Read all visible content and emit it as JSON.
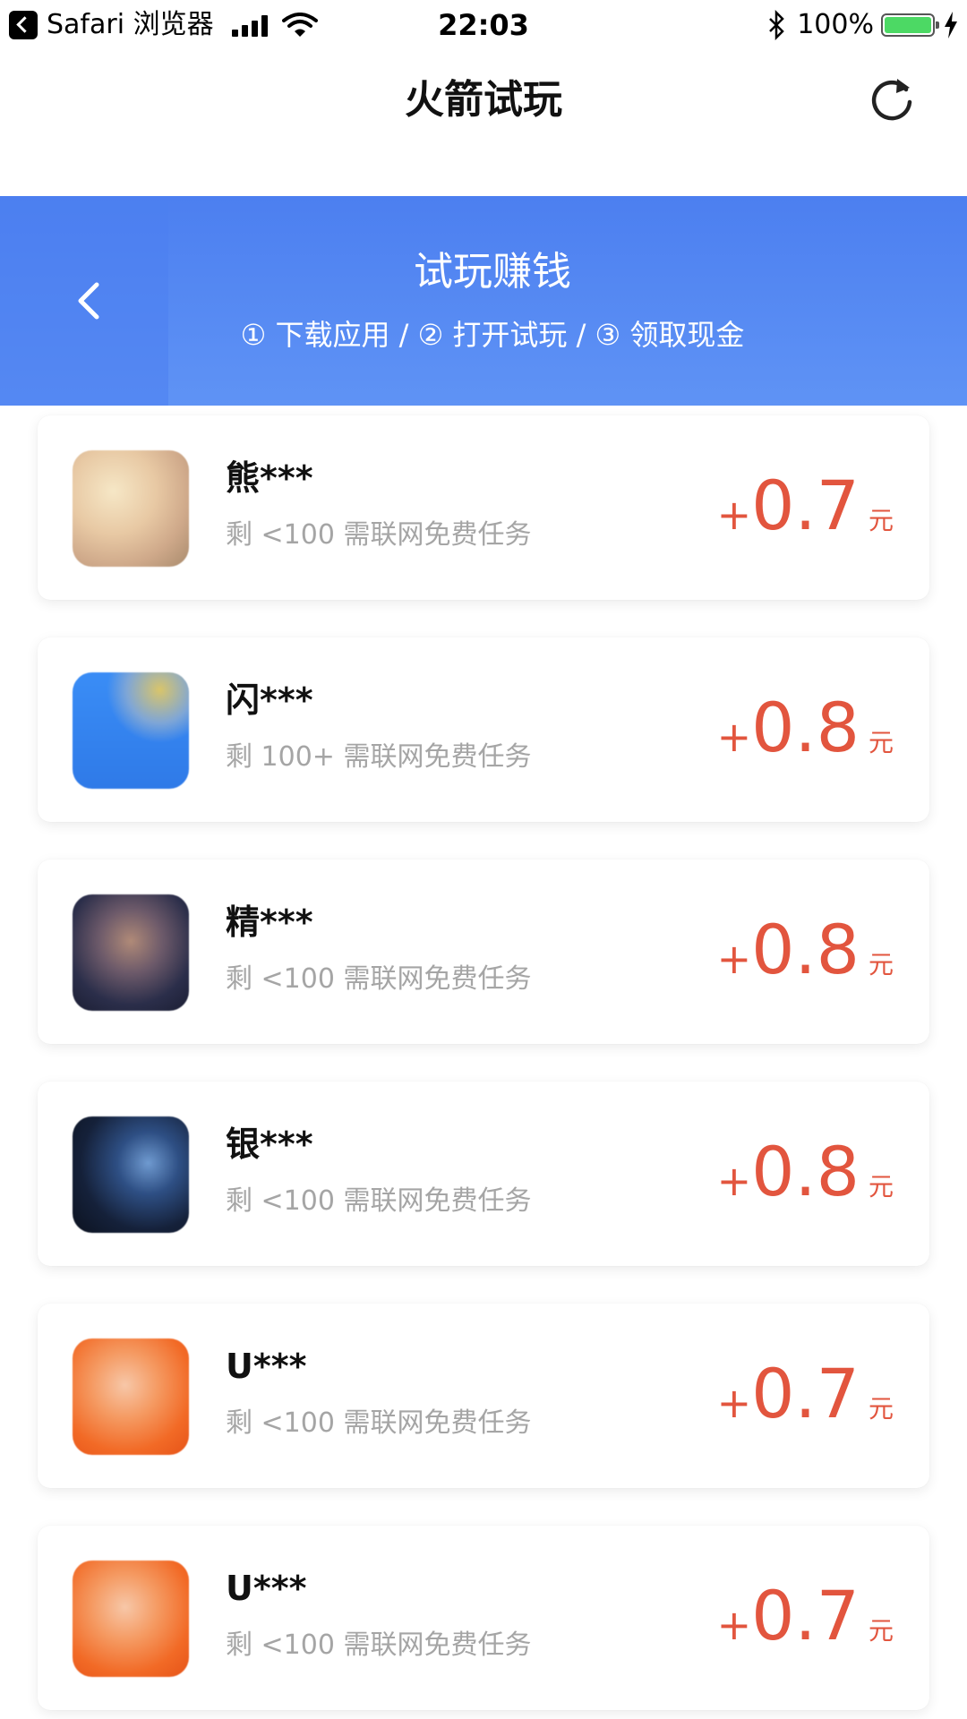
{
  "status_bar": {
    "back_app_label": "Safari 浏览器",
    "time": "22:03",
    "battery_percent": "100%",
    "battery_color": "#4cd964"
  },
  "nav": {
    "title": "火箭试玩",
    "refresh_icon": "refresh-icon"
  },
  "banner": {
    "title": "试玩赚钱",
    "steps": "① 下载应用 / ② 打开试玩 / ③ 领取现金",
    "background": "#5a8cf3"
  },
  "tasks": [
    {
      "name": "熊***",
      "subtitle": "剩 <100 需联网免费任务",
      "plus": "+",
      "amount": "0.7",
      "unit": "元"
    },
    {
      "name": "闪***",
      "subtitle": "剩 100+ 需联网免费任务",
      "plus": "+",
      "amount": "0.8",
      "unit": "元"
    },
    {
      "name": "精***",
      "subtitle": "剩 <100 需联网免费任务",
      "plus": "+",
      "amount": "0.8",
      "unit": "元"
    },
    {
      "name": "银***",
      "subtitle": "剩 <100 需联网免费任务",
      "plus": "+",
      "amount": "0.8",
      "unit": "元"
    },
    {
      "name": "U***",
      "subtitle": "剩 <100 需联网免费任务",
      "plus": "+",
      "amount": "0.7",
      "unit": "元"
    },
    {
      "name": "U***",
      "subtitle": "剩 <100 需联网免费任务",
      "plus": "+",
      "amount": "0.7",
      "unit": "元"
    }
  ],
  "colors": {
    "accent_red": "#e2553e",
    "subtitle_gray": "#a5a5a5"
  }
}
